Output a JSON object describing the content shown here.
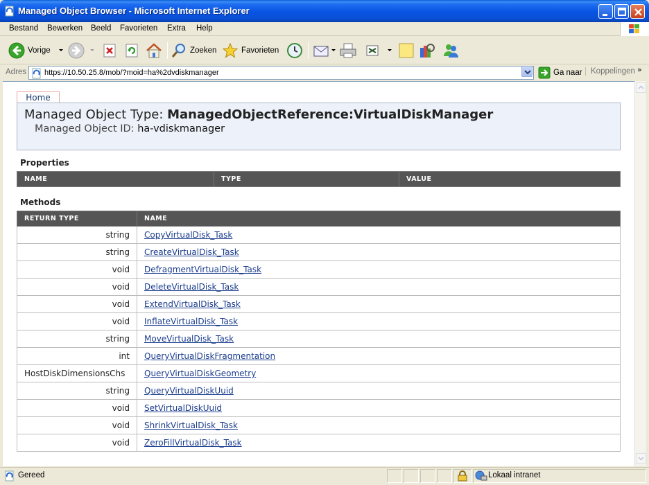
{
  "window": {
    "title": "Managed Object Browser - Microsoft Internet Explorer"
  },
  "menu": {
    "items": [
      "Bestand",
      "Bewerken",
      "Beeld",
      "Favorieten",
      "Extra",
      "Help"
    ]
  },
  "toolbar": {
    "back_label": "Vorige",
    "search_label": "Zoeken",
    "favorites_label": "Favorieten"
  },
  "address": {
    "label": "Adres",
    "url": "https://10.50.25.8/mob/?moid=ha%2dvdiskmanager",
    "go_label": "Ga naar",
    "links_label": "Koppelingen",
    "chevron": "»"
  },
  "page": {
    "home_tab": "Home",
    "type_prefix": "Managed Object Type: ",
    "type_value": "ManagedObjectReference:VirtualDiskManager",
    "id_prefix": "Managed Object ID: ",
    "id_value": "ha-vdiskmanager",
    "properties_title": "Properties",
    "properties_columns": [
      "NAME",
      "TYPE",
      "VALUE"
    ],
    "methods_title": "Methods",
    "methods_columns": [
      "RETURN TYPE",
      "NAME"
    ],
    "methods": [
      {
        "ret": "string",
        "name": "CopyVirtualDisk_Task"
      },
      {
        "ret": "string",
        "name": "CreateVirtualDisk_Task"
      },
      {
        "ret": "void",
        "name": "DefragmentVirtualDisk_Task"
      },
      {
        "ret": "void",
        "name": "DeleteVirtualDisk_Task"
      },
      {
        "ret": "void",
        "name": "ExtendVirtualDisk_Task"
      },
      {
        "ret": "void",
        "name": "InflateVirtualDisk_Task"
      },
      {
        "ret": "string",
        "name": "MoveVirtualDisk_Task"
      },
      {
        "ret": "int",
        "name": "QueryVirtualDiskFragmentation"
      },
      {
        "ret": "HostDiskDimensionsChs",
        "name": "QueryVirtualDiskGeometry"
      },
      {
        "ret": "string",
        "name": "QueryVirtualDiskUuid"
      },
      {
        "ret": "void",
        "name": "SetVirtualDiskUuid"
      },
      {
        "ret": "void",
        "name": "ShrinkVirtualDisk_Task"
      },
      {
        "ret": "void",
        "name": "ZeroFillVirtualDisk_Task"
      }
    ]
  },
  "status": {
    "text": "Gereed",
    "zone": "Lokaal intranet"
  },
  "icons": {
    "app": "ie-page-icon",
    "back": "back-arrow-icon",
    "forward": "forward-arrow-icon",
    "stop": "stop-icon",
    "refresh": "refresh-icon",
    "home": "home-icon",
    "search": "search-icon",
    "favorites": "star-icon",
    "history": "history-icon",
    "mail": "mail-icon",
    "print": "print-icon",
    "edit": "edit-icon",
    "discuss": "note-icon",
    "research": "research-icon",
    "messenger": "messenger-icon",
    "go": "go-arrow-icon",
    "lock": "lock-icon",
    "zone": "intranet-icon"
  }
}
